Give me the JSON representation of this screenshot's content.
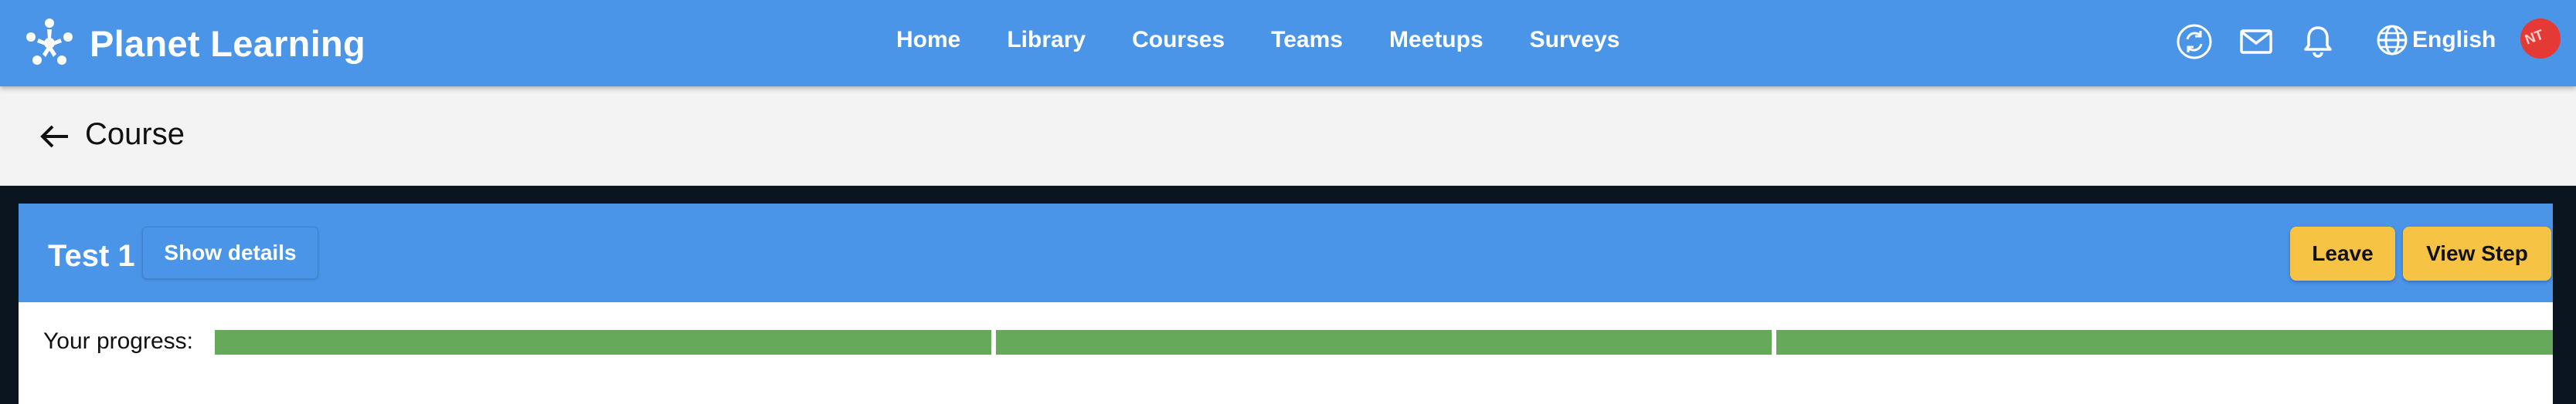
{
  "app": {
    "name": "Planet Learning"
  },
  "nav": {
    "items": [
      "Home",
      "Library",
      "Courses",
      "Teams",
      "Meetups",
      "Surveys"
    ]
  },
  "header_icons": [
    "sync-icon",
    "mail-icon",
    "bell-icon",
    "globe-icon"
  ],
  "language": {
    "label": "English"
  },
  "avatar": {
    "text": "NT"
  },
  "page": {
    "title": "Course"
  },
  "course": {
    "name": "Test 1",
    "show_details_label": "Show details",
    "leave_label": "Leave",
    "view_step_label": "View Step"
  },
  "progress": {
    "label": "Your progress:",
    "steps_total": 3,
    "steps_completed": 3
  },
  "colors": {
    "primary": "#4a95e8",
    "accent": "#f6c344",
    "progress_complete": "#66a95a",
    "subheader_bg": "#f3f3f3"
  }
}
